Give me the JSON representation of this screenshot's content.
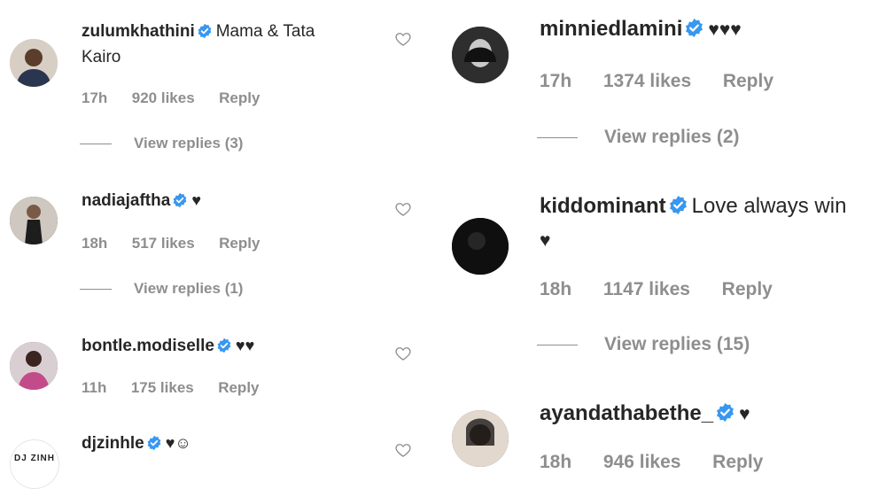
{
  "comments_left": [
    {
      "username": "zulumkhathini",
      "text_line1": "Mama & Tata",
      "text_line2": "Kairo",
      "time": "17h",
      "likes": "920 likes",
      "reply": "Reply",
      "view_replies": "View replies (3)"
    },
    {
      "username": "nadiajaftha",
      "text_line1": "",
      "hearts": "♥",
      "time": "18h",
      "likes": "517 likes",
      "reply": "Reply",
      "view_replies": "View replies (1)"
    },
    {
      "username": "bontle.modiselle",
      "text_line1": "",
      "hearts": "♥♥",
      "time": "11h",
      "likes": "175 likes",
      "reply": "Reply"
    },
    {
      "username": "djzinhle",
      "hearts": "♥☺",
      "avatar_text": "DJ ZINH"
    }
  ],
  "comments_right": [
    {
      "username": "minniedlamini",
      "hearts": "♥♥♥",
      "time": "17h",
      "likes": "1374 likes",
      "reply": "Reply",
      "view_replies": "View replies (2)"
    },
    {
      "username": "kiddominant",
      "text_line1": "Love always win",
      "hearts": "♥",
      "time": "18h",
      "likes": "1147 likes",
      "reply": "Reply",
      "view_replies": "View replies (15)"
    },
    {
      "username": "ayandathabethe_",
      "hearts": "♥",
      "time": "18h",
      "likes": "946 likes",
      "reply": "Reply"
    }
  ],
  "colors": {
    "text": "#262626",
    "muted": "#8e8e8e",
    "verified": "#3897f0"
  },
  "icons": {
    "verified": "verified-badge-icon",
    "like": "heart-outline-icon"
  }
}
